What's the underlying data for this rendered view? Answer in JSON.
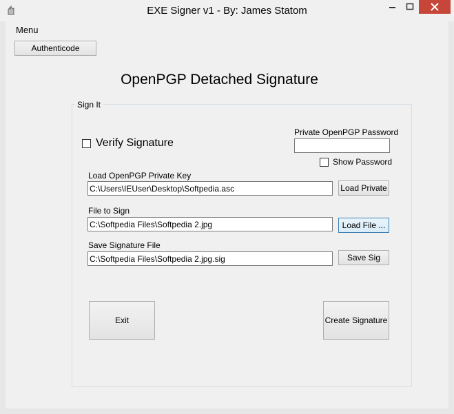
{
  "window": {
    "title": "EXE Signer v1 - By: James Statom"
  },
  "menu": {
    "label": "Menu"
  },
  "toolbar": {
    "authenticode_label": "Authenticode"
  },
  "main": {
    "heading": "OpenPGP Detached Signature"
  },
  "sign_group": {
    "label": "Sign It",
    "verify_label": "Verify Signature",
    "password_label": "Private OpenPGP Password",
    "password_value": "",
    "show_password_label": "Show Password",
    "private_key_label": "Load OpenPGP Private Key",
    "private_key_value": "C:\\Users\\IEUser\\Desktop\\Softpedia.asc",
    "load_private_label": "Load Private",
    "file_label": "File to Sign",
    "file_value": "C:\\Softpedia Files\\Softpedia 2.jpg",
    "load_file_label": "Load File ...",
    "save_label": "Save Signature File",
    "save_value": "C:\\Softpedia Files\\Softpedia 2.jpg.sig",
    "save_sig_label": "Save Sig",
    "exit_label": "Exit",
    "create_label": "Create Signature"
  },
  "colors": {
    "window_bg": "#f0f0f0",
    "close_button": "#c7463a",
    "focus_border": "#3c7fb1"
  },
  "icons": {
    "app": "app-icon",
    "minimize": "minimize-icon",
    "maximize": "maximize-icon",
    "close": "close-icon"
  }
}
